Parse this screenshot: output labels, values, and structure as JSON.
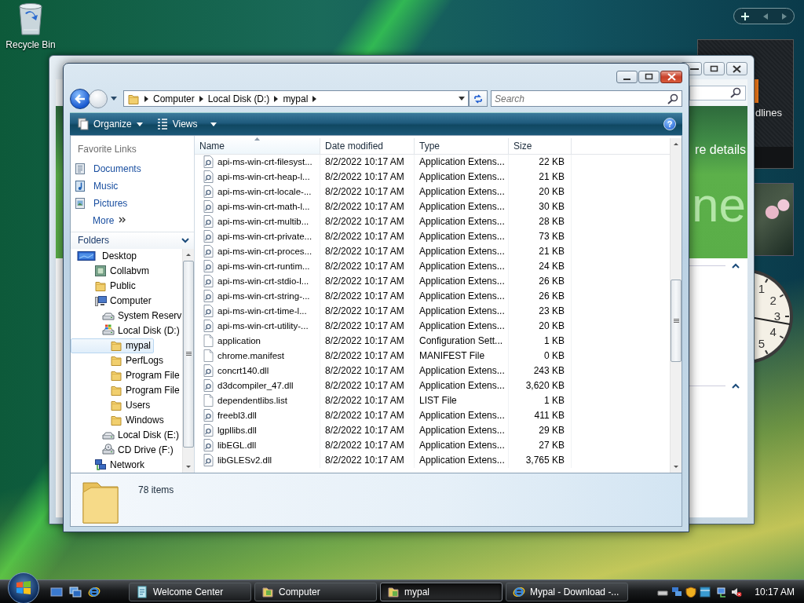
{
  "desktop_icons": [
    {
      "label": "Recycle Bin",
      "kind": "recycle"
    }
  ],
  "gadgets": {
    "headlines_text": "dlines",
    "clock_numbers": [
      "1",
      "2",
      "3",
      "4",
      "5"
    ]
  },
  "background_window": {
    "banner_text": "re details",
    "banner_watermark": "ne"
  },
  "explorer": {
    "breadcrumb": [
      "Computer",
      "Local Disk (D:)",
      "mypal"
    ],
    "search": {
      "placeholder": "Search"
    },
    "toolbar": [
      {
        "label": "Organize",
        "kind": "organize"
      },
      {
        "label": "Views",
        "kind": "views"
      }
    ],
    "help_button": "?",
    "favorite_links": {
      "title": "Favorite Links",
      "items": [
        {
          "label": "Documents",
          "kind": "documents"
        },
        {
          "label": "Music",
          "kind": "music"
        },
        {
          "label": "Pictures",
          "kind": "pictures"
        },
        {
          "label": "More",
          "kind": "more"
        }
      ]
    },
    "folders": {
      "title": "Folders",
      "tree": [
        {
          "label": "Desktop",
          "kind": "desktop",
          "selected": false,
          "children": [
            {
              "label": "Collabvm",
              "kind": "user",
              "selected": false
            },
            {
              "label": "Public",
              "kind": "folder",
              "selected": false
            },
            {
              "label": "Computer",
              "kind": "computer",
              "selected": false,
              "children": [
                {
                  "label": "System Reserv",
                  "kind": "drive",
                  "selected": false
                },
                {
                  "label": "Local Disk (D:)",
                  "kind": "windrive",
                  "selected": false,
                  "children": [
                    {
                      "label": "mypal",
                      "kind": "folder",
                      "selected": true
                    },
                    {
                      "label": "PerfLogs",
                      "kind": "folder",
                      "selected": false
                    },
                    {
                      "label": "Program File",
                      "kind": "folder",
                      "selected": false
                    },
                    {
                      "label": "Program File",
                      "kind": "folder",
                      "selected": false
                    },
                    {
                      "label": "Users",
                      "kind": "folder",
                      "selected": false
                    },
                    {
                      "label": "Windows",
                      "kind": "folder",
                      "selected": false
                    }
                  ]
                },
                {
                  "label": "Local Disk (E:)",
                  "kind": "drive",
                  "selected": false
                },
                {
                  "label": "CD Drive (F:)",
                  "kind": "cd",
                  "selected": false
                }
              ]
            },
            {
              "label": "Network",
              "kind": "network",
              "selected": false
            }
          ]
        }
      ]
    },
    "columns": [
      {
        "label": "Name",
        "sorted": true
      },
      {
        "label": "Date modified",
        "sorted": false
      },
      {
        "label": "Type",
        "sorted": false
      },
      {
        "label": "Size",
        "sorted": false
      }
    ],
    "rows": [
      {
        "name": "api-ms-win-crt-filesyst...",
        "date": "8/2/2022 10:17 AM",
        "type": "Application Extens...",
        "size": "22 KB",
        "kind": "extension"
      },
      {
        "name": "api-ms-win-crt-heap-l...",
        "date": "8/2/2022 10:17 AM",
        "type": "Application Extens...",
        "size": "21 KB",
        "kind": "extension"
      },
      {
        "name": "api-ms-win-crt-locale-...",
        "date": "8/2/2022 10:17 AM",
        "type": "Application Extens...",
        "size": "20 KB",
        "kind": "extension"
      },
      {
        "name": "api-ms-win-crt-math-l...",
        "date": "8/2/2022 10:17 AM",
        "type": "Application Extens...",
        "size": "30 KB",
        "kind": "extension"
      },
      {
        "name": "api-ms-win-crt-multib...",
        "date": "8/2/2022 10:17 AM",
        "type": "Application Extens...",
        "size": "28 KB",
        "kind": "extension"
      },
      {
        "name": "api-ms-win-crt-private...",
        "date": "8/2/2022 10:17 AM",
        "type": "Application Extens...",
        "size": "73 KB",
        "kind": "extension"
      },
      {
        "name": "api-ms-win-crt-proces...",
        "date": "8/2/2022 10:17 AM",
        "type": "Application Extens...",
        "size": "21 KB",
        "kind": "extension"
      },
      {
        "name": "api-ms-win-crt-runtim...",
        "date": "8/2/2022 10:17 AM",
        "type": "Application Extens...",
        "size": "24 KB",
        "kind": "extension"
      },
      {
        "name": "api-ms-win-crt-stdio-l...",
        "date": "8/2/2022 10:17 AM",
        "type": "Application Extens...",
        "size": "26 KB",
        "kind": "extension"
      },
      {
        "name": "api-ms-win-crt-string-...",
        "date": "8/2/2022 10:17 AM",
        "type": "Application Extens...",
        "size": "26 KB",
        "kind": "extension"
      },
      {
        "name": "api-ms-win-crt-time-l...",
        "date": "8/2/2022 10:17 AM",
        "type": "Application Extens...",
        "size": "23 KB",
        "kind": "extension"
      },
      {
        "name": "api-ms-win-crt-utility-...",
        "date": "8/2/2022 10:17 AM",
        "type": "Application Extens...",
        "size": "20 KB",
        "kind": "extension"
      },
      {
        "name": "application",
        "date": "8/2/2022 10:17 AM",
        "type": "Configuration Sett...",
        "size": "1 KB",
        "kind": "plain"
      },
      {
        "name": "chrome.manifest",
        "date": "8/2/2022 10:17 AM",
        "type": "MANIFEST File",
        "size": "0 KB",
        "kind": "plain"
      },
      {
        "name": "concrt140.dll",
        "date": "8/2/2022 10:17 AM",
        "type": "Application Extens...",
        "size": "243 KB",
        "kind": "extension"
      },
      {
        "name": "d3dcompiler_47.dll",
        "date": "8/2/2022 10:17 AM",
        "type": "Application Extens...",
        "size": "3,620 KB",
        "kind": "extension"
      },
      {
        "name": "dependentlibs.list",
        "date": "8/2/2022 10:17 AM",
        "type": "LIST File",
        "size": "1 KB",
        "kind": "plain"
      },
      {
        "name": "freebl3.dll",
        "date": "8/2/2022 10:17 AM",
        "type": "Application Extens...",
        "size": "411 KB",
        "kind": "extension"
      },
      {
        "name": "lgpllibs.dll",
        "date": "8/2/2022 10:17 AM",
        "type": "Application Extens...",
        "size": "29 KB",
        "kind": "extension"
      },
      {
        "name": "libEGL.dll",
        "date": "8/2/2022 10:17 AM",
        "type": "Application Extens...",
        "size": "27 KB",
        "kind": "extension"
      },
      {
        "name": "libGLESv2.dll",
        "date": "8/2/2022 10:17 AM",
        "type": "Application Extens...",
        "size": "3,765 KB",
        "kind": "extension"
      }
    ],
    "details": {
      "item_count": "78 items"
    }
  },
  "taskbar": {
    "buttons": [
      {
        "label": "Welcome Center",
        "kind": "welcome",
        "selected": false
      },
      {
        "label": "Computer",
        "kind": "computer",
        "selected": false
      },
      {
        "label": "mypal",
        "kind": "folder",
        "selected": true
      },
      {
        "label": "Mypal - Download -...",
        "kind": "browser",
        "selected": false
      }
    ],
    "clock": "10:17 AM"
  }
}
